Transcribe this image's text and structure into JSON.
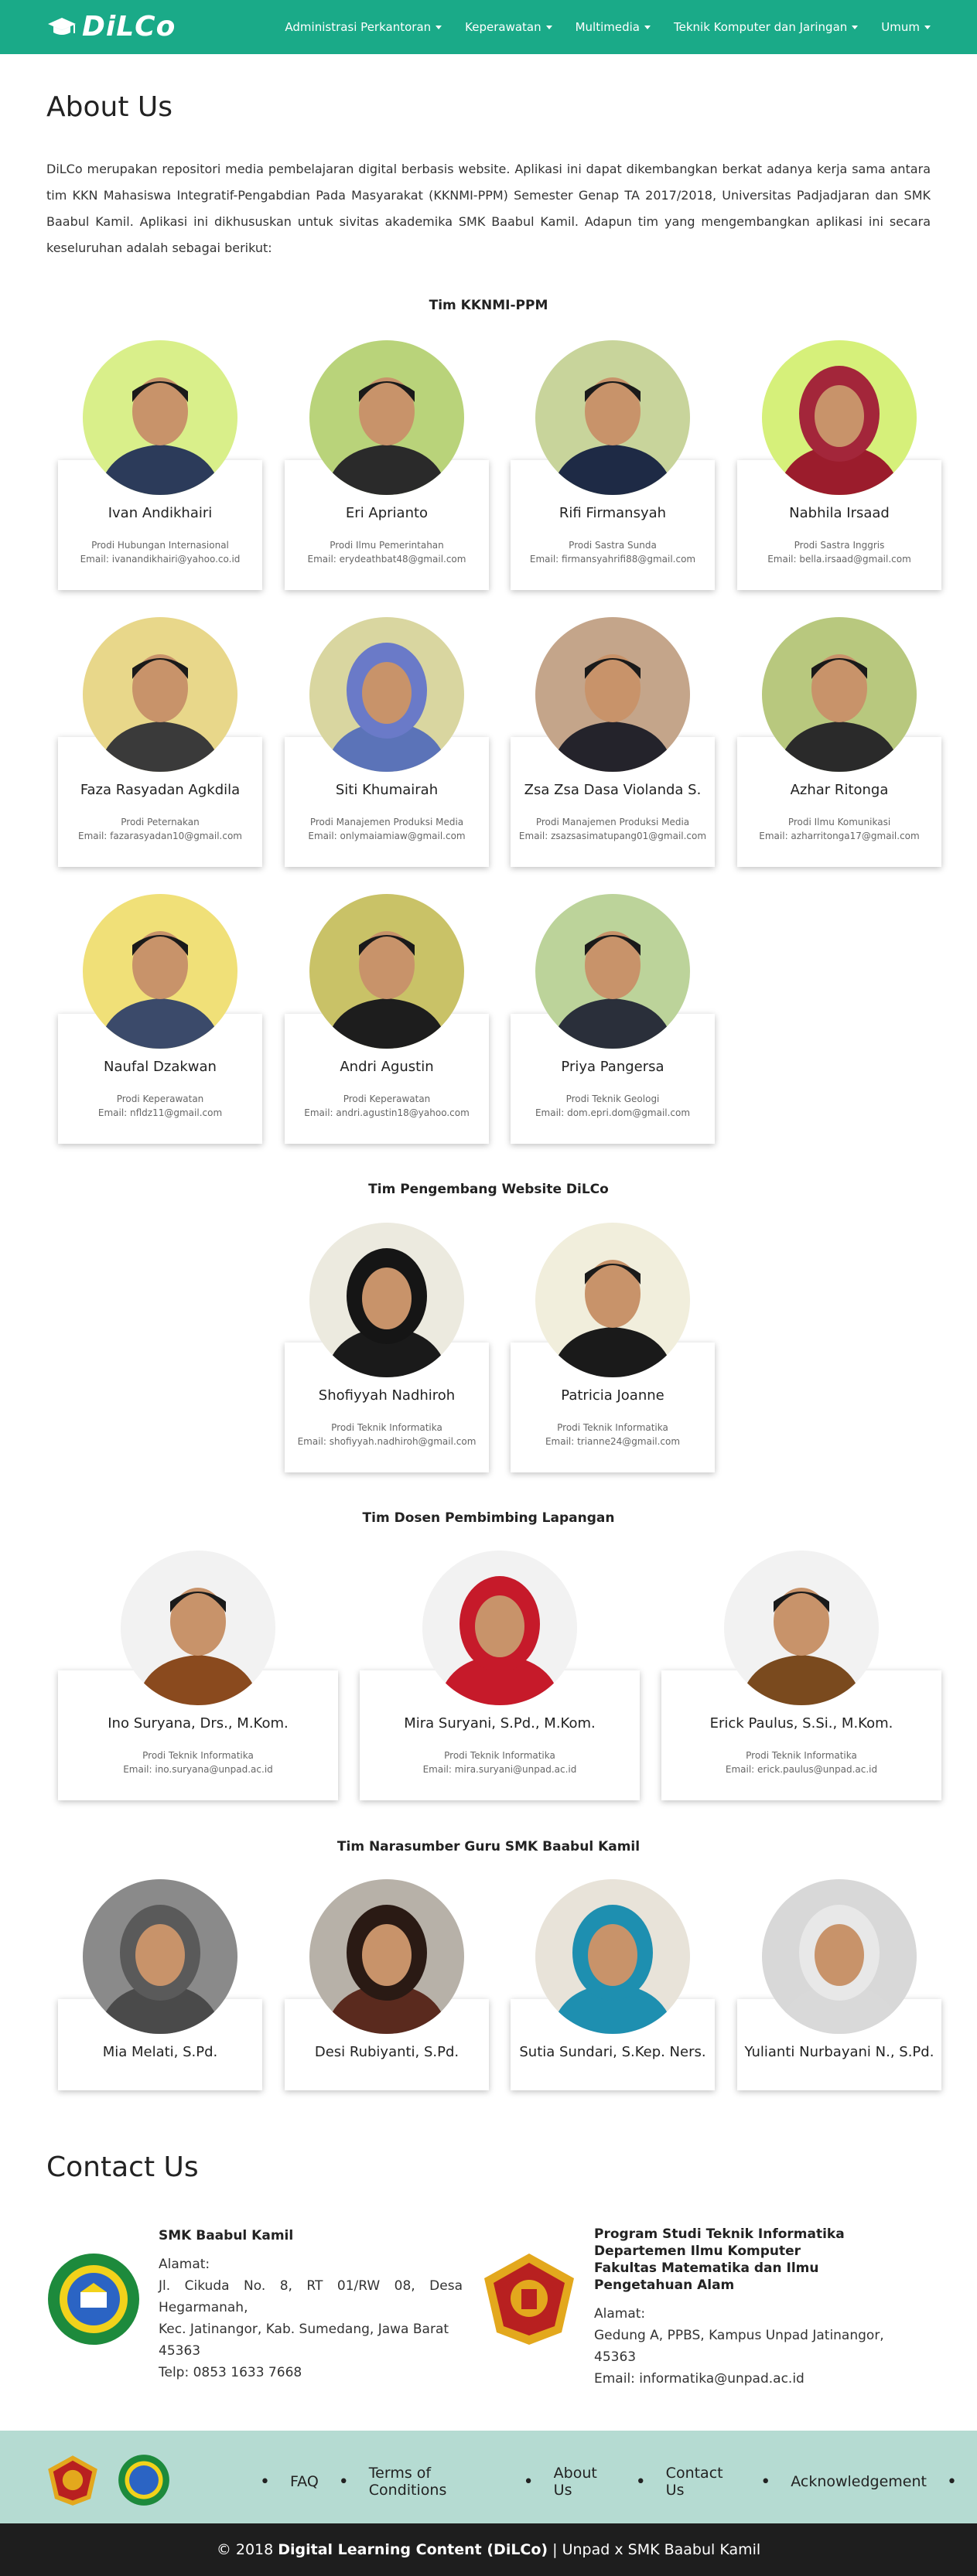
{
  "navbar": {
    "brand": "DiLCo",
    "menu": [
      {
        "label": "Administrasi Perkantoran"
      },
      {
        "label": "Keperawatan"
      },
      {
        "label": "Multimedia"
      },
      {
        "label": "Teknik Komputer dan Jaringan"
      },
      {
        "label": "Umum"
      }
    ]
  },
  "about": {
    "title": "About Us",
    "text": "DiLCo merupakan repositori media pembelajaran digital berbasis website. Aplikasi ini dapat dikembangkan berkat adanya kerja sama antara tim KKN Mahasiswa Integratif-Pengabdian Pada Masyarakat (KKNMI-PPM) Semester Genap TA 2017/2018, Universitas Padjadjaran dan SMK Baabul Kamil. Aplikasi ini dikhususkan untuk sivitas akademika SMK Baabul Kamil. Adapun tim yang mengembangkan aplikasi ini secara keseluruhan adalah sebagai berikut:"
  },
  "teams": {
    "kknmi": {
      "title": "Tim KKNMI-PPM",
      "members": [
        {
          "name": "Ivan Andikhairi",
          "prodi": "Prodi Hubungan Internasional",
          "email": "Email: ivanandikhairi@yahoo.co.id"
        },
        {
          "name": "Eri Aprianto",
          "prodi": "Prodi Ilmu Pemerintahan",
          "email": "Email: erydeathbat48@gmail.com"
        },
        {
          "name": "Rifi Firmansyah",
          "prodi": "Prodi Sastra Sunda",
          "email": "Email: firmansyahrifi88@gmail.com"
        },
        {
          "name": "Nabhila Irsaad",
          "prodi": "Prodi Sastra Inggris",
          "email": "Email: bella.irsaad@gmail.com"
        },
        {
          "name": "Faza Rasyadan Agkdila",
          "prodi": "Prodi Peternakan",
          "email": "Email: fazarasyadan10@gmail.com"
        },
        {
          "name": "Siti Khumairah",
          "prodi": "Prodi Manajemen Produksi Media",
          "email": "Email: onlymaiamiaw@gmail.com"
        },
        {
          "name": "Zsa Zsa Dasa Violanda S.",
          "prodi": "Prodi Manajemen Produksi Media",
          "email": "Email: zsazsasimatupang01@gmail.com"
        },
        {
          "name": "Azhar Ritonga",
          "prodi": "Prodi Ilmu Komunikasi",
          "email": "Email: azharritonga17@gmail.com"
        },
        {
          "name": "Naufal Dzakwan",
          "prodi": "Prodi Keperawatan",
          "email": "Email: nfldz11@gmail.com"
        },
        {
          "name": "Andri Agustin",
          "prodi": "Prodi Keperawatan",
          "email": "Email: andri.agustin18@yahoo.com"
        },
        {
          "name": "Priya Pangersa",
          "prodi": "Prodi Teknik Geologi",
          "email": "Email: dom.epri.dom@gmail.com"
        }
      ]
    },
    "web": {
      "title": "Tim Pengembang Website DiLCo",
      "members": [
        {
          "name": "Shofiyyah Nadhiroh",
          "prodi": "Prodi Teknik Informatika",
          "email": "Email: shofiyyah.nadhiroh@gmail.com"
        },
        {
          "name": "Patricia Joanne",
          "prodi": "Prodi Teknik Informatika",
          "email": "Email: trianne24@gmail.com"
        }
      ]
    },
    "dosen": {
      "title": "Tim Dosen Pembimbing Lapangan",
      "members": [
        {
          "name": "Ino Suryana, Drs., M.Kom.",
          "prodi": "Prodi Teknik Informatika",
          "email": "Email: ino.suryana@unpad.ac.id"
        },
        {
          "name": "Mira Suryani, S.Pd., M.Kom.",
          "prodi": "Prodi Teknik Informatika",
          "email": "Email: mira.suryani@unpad.ac.id"
        },
        {
          "name": "Erick Paulus, S.Si., M.Kom.",
          "prodi": "Prodi Teknik Informatika",
          "email": "Email: erick.paulus@unpad.ac.id"
        }
      ]
    },
    "guru": {
      "title": "Tim Narasumber Guru SMK Baabul Kamil",
      "members": [
        {
          "name": "Mia Melati, S.Pd."
        },
        {
          "name": "Desi Rubiyanti, S.Pd."
        },
        {
          "name": "Sutia Sundari, S.Kep. Ners."
        },
        {
          "name": "Yulianti Nurbayani N., S.Pd."
        }
      ]
    }
  },
  "contact": {
    "title": "Contact Us",
    "smk": {
      "org": "SMK Baabul Kamil",
      "label": "Alamat:",
      "address1": "Jl. Cikuda No. 8, RT 01/RW 08, Desa Hegarmanah,",
      "address2": "Kec. Jatinangor, Kab. Sumedang, Jawa Barat 45363",
      "phone": "Telp: 0853 1633 7668"
    },
    "unpad": {
      "org1": "Program Studi Teknik Informatika",
      "org2": "Departemen Ilmu Komputer",
      "org3": "Fakultas Matematika dan Ilmu Pengetahuan Alam",
      "label": "Alamat:",
      "address": "Gedung A, PPBS, Kampus Unpad Jatinangor, 45363",
      "email": "Email: informatika@unpad.ac.id"
    }
  },
  "footer": {
    "links": [
      "FAQ",
      "Terms of Conditions",
      "About Us",
      "Contact Us",
      "Acknowledgement"
    ],
    "copyright_prefix": "© 2018 ",
    "copyright_brand": "Digital Learning Content (DiLCo)",
    "copyright_suffix": " | Unpad x SMK Baabul Kamil"
  },
  "colors": {
    "primary": "#1aaa88",
    "footer_bg": "#b5dbd2",
    "copyright_bg": "#1e1e1e"
  }
}
